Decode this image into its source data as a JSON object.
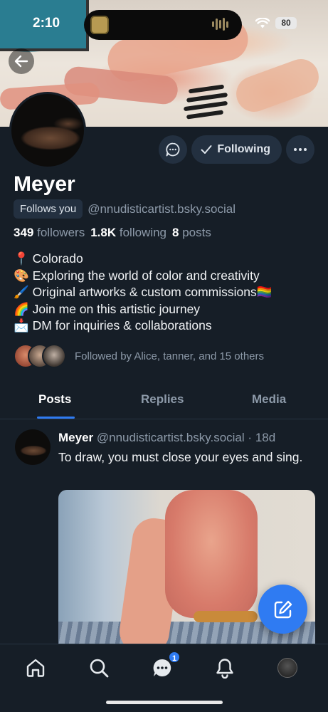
{
  "status_bar": {
    "time": "2:10",
    "battery": "80"
  },
  "profile": {
    "name": "Meyer",
    "follows_you": "Follows you",
    "handle": "@nnudisticartist.bsky.social",
    "stats": {
      "followers_count": "349",
      "followers_label": "followers",
      "following_count": "1.8K",
      "following_label": "following",
      "posts_count": "8",
      "posts_label": "posts"
    },
    "following_button": "Following",
    "bio": [
      {
        "emoji": "📍",
        "text": "Colorado"
      },
      {
        "emoji": "🎨",
        "text": "Exploring the world of color and creativity"
      },
      {
        "emoji": "🖌️",
        "text": "Original artworks & custom commissions🏳️‍🌈"
      },
      {
        "emoji": "🌈",
        "text": "Join me on this artistic journey"
      },
      {
        "emoji": "📩",
        "text": "DM for inquiries & collaborations"
      }
    ],
    "followed_by": "Followed by Alice, tanner, and 15 others"
  },
  "tabs": [
    "Posts",
    "Replies",
    "Media"
  ],
  "active_tab": "Posts",
  "post": {
    "author": "Meyer",
    "handle": "@nnudisticartist.bsky.social",
    "separator": "·",
    "age": "18d",
    "text": "To draw, you must close your eyes and sing."
  },
  "bottom_nav": {
    "items": [
      "home-icon",
      "search-icon",
      "chat-icon",
      "bell-icon",
      "profile-avatar"
    ],
    "chat_badge": "1"
  },
  "colors": {
    "accent": "#2f7bf2",
    "background": "#161e27",
    "muted": "#8d9aa9"
  }
}
